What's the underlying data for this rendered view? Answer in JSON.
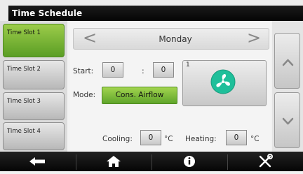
{
  "header": {
    "title": "Time Schedule"
  },
  "slots": [
    {
      "label": "Time Slot 1",
      "active": true
    },
    {
      "label": "Time Slot 2",
      "active": false
    },
    {
      "label": "Time Slot 3",
      "active": false
    },
    {
      "label": "Time Slot 4",
      "active": false
    }
  ],
  "day": {
    "prev_glyph": "<",
    "name": "Monday",
    "next_glyph": ">"
  },
  "start": {
    "label": "Start:",
    "hour": "0",
    "separator": ":",
    "minute": "0"
  },
  "mode": {
    "label": "Mode:",
    "value": "Cons. Airflow"
  },
  "fan": {
    "id": "1",
    "icon": "fan-icon",
    "accent": "#1fbf9a"
  },
  "cooling": {
    "label": "Cooling:",
    "value": "0",
    "unit": "°C"
  },
  "heating": {
    "label": "Heating:",
    "value": "0",
    "unit": "°C"
  },
  "scroll": {
    "up_icon": "chevron-up-icon",
    "down_icon": "chevron-down-icon"
  },
  "footer": {
    "icons": [
      "back-arrow-icon",
      "home-icon",
      "info-icon",
      "tools-icon"
    ]
  },
  "colors": {
    "active_green": "#7ab83a",
    "header_bg": "#0a0a0a",
    "footer_bg": "#111111"
  }
}
